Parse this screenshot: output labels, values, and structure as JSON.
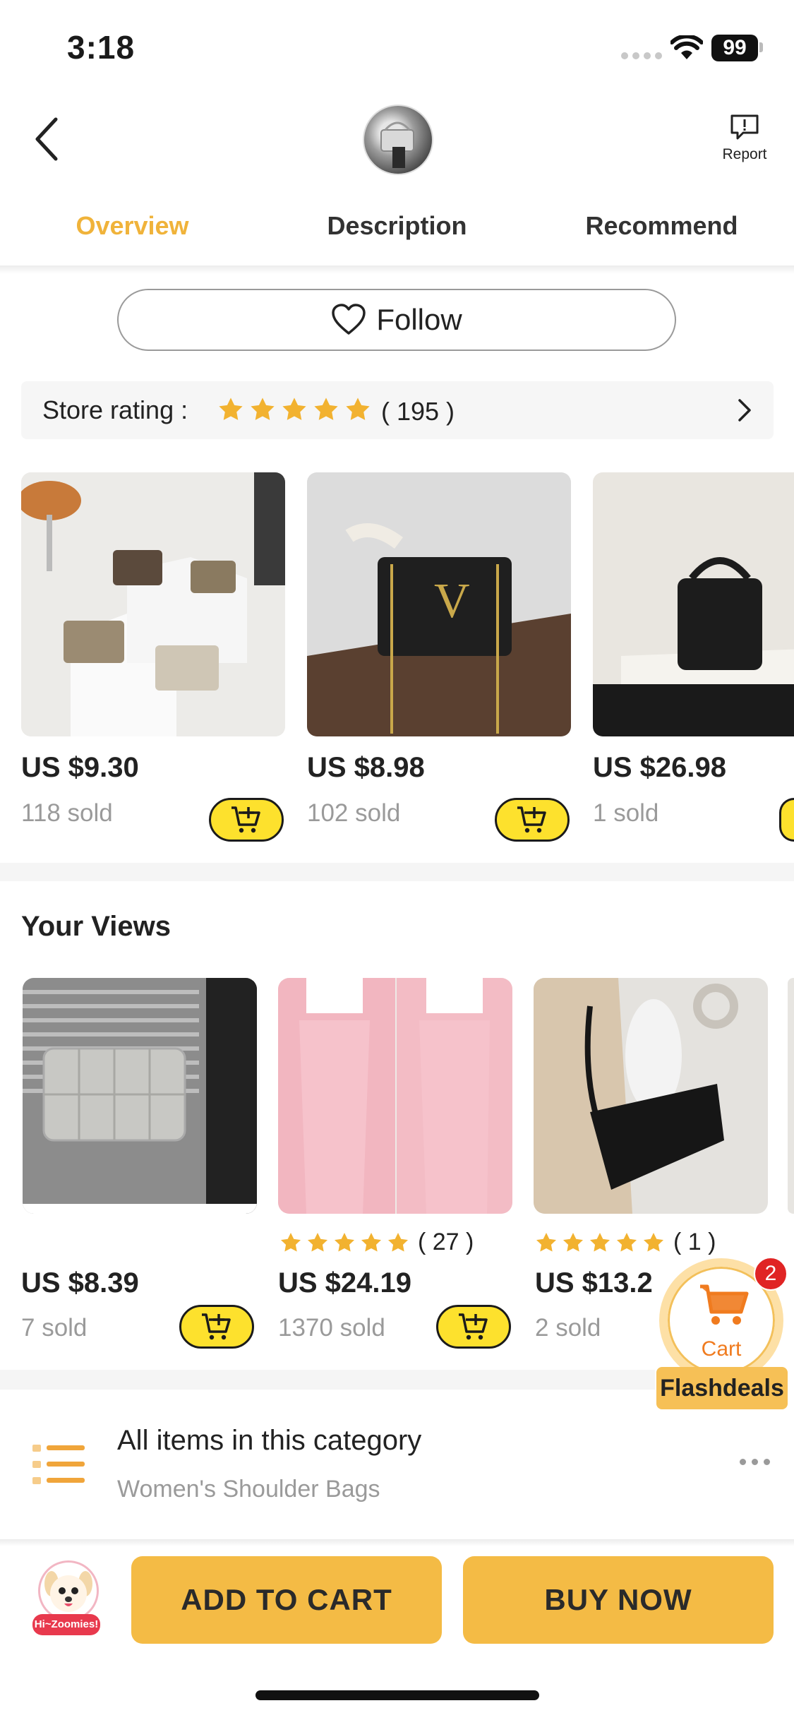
{
  "status_bar": {
    "time": "3:18",
    "battery": "99"
  },
  "header": {
    "report_label": "Report",
    "tabs": [
      "Overview",
      "Description",
      "Recommend"
    ],
    "active_tab": "Overview"
  },
  "follow": {
    "label": "Follow"
  },
  "store_rating": {
    "label": "Store rating :",
    "stars": 5,
    "count": "( 195 )"
  },
  "store_products": [
    {
      "price": "US $9.30",
      "sold": "118 sold"
    },
    {
      "price": "US $8.98",
      "sold": "102 sold"
    },
    {
      "price": "US $26.98",
      "sold": "1 sold"
    }
  ],
  "your_views": {
    "title": "Your Views",
    "items": [
      {
        "price": "US $8.39",
        "sold": "7 sold"
      },
      {
        "price": "US $24.19",
        "sold": "1370 sold",
        "rating_count": "( 27 )"
      },
      {
        "price": "US $13.2",
        "sold": "2 sold",
        "rating_count": "( 1 )"
      }
    ]
  },
  "float_cart": {
    "label": "Cart",
    "badge": "2",
    "flash_label": "Flashdeals"
  },
  "category": {
    "title": "All items in this category",
    "subtitle": "Women's Shoulder Bags"
  },
  "bottom_bar": {
    "mascot_tag": "Hi~Zoomies!",
    "add_to_cart": "ADD TO CART",
    "buy_now": "BUY NOW"
  },
  "colors": {
    "accent": "#f0b33a",
    "cart_button": "#fde12d",
    "primary_button": "#f4bb45",
    "star": "#f2b230"
  },
  "icons": [
    "back-icon",
    "report-icon",
    "heart-icon",
    "star-icon",
    "chevron-right-icon",
    "cart-add-icon",
    "cart-icon",
    "list-icon",
    "more-icon"
  ]
}
